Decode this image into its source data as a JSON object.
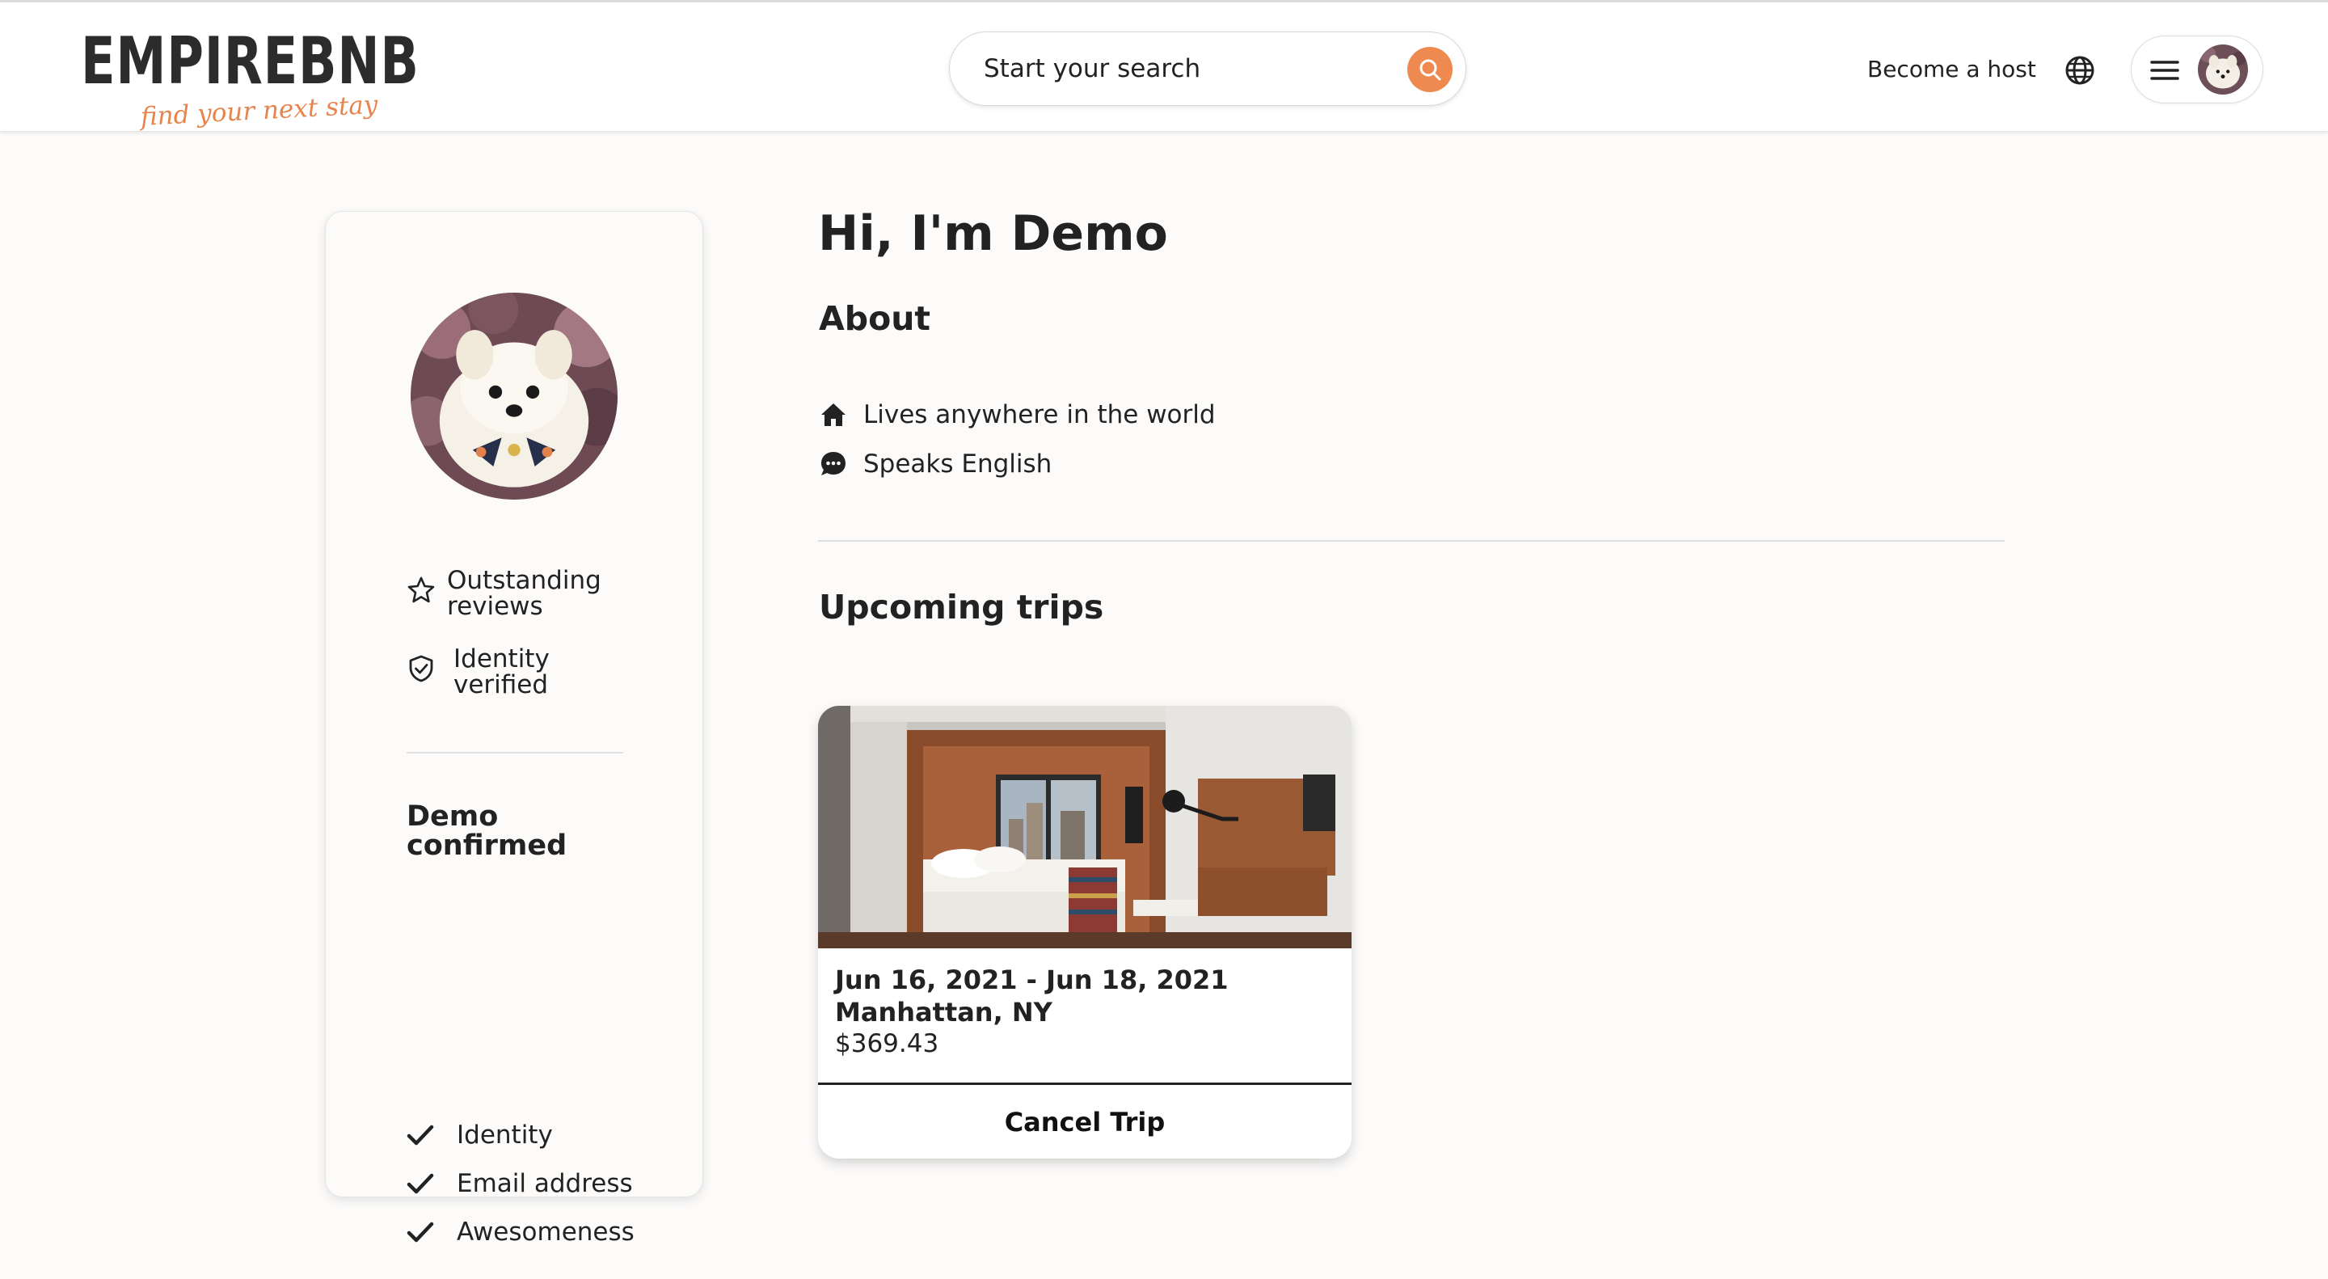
{
  "brand": {
    "name": "EMPIREBNB",
    "tagline": "find your next stay",
    "accent_color": "#ee8a4f"
  },
  "header": {
    "search": {
      "placeholder": "Start your search",
      "icon": "search-icon"
    },
    "become_host_label": "Become a host",
    "globe_icon": "globe-icon",
    "menu_icon": "hamburger-menu-icon",
    "avatar": "user-avatar"
  },
  "profile_card": {
    "badges": [
      {
        "icon": "star-icon",
        "label": "Outstanding reviews"
      },
      {
        "icon": "shield-check-icon",
        "label": "Identity verified"
      }
    ],
    "confirmed_title": "Demo confirmed",
    "confirmed_items": [
      "Identity",
      "Email address",
      "Awesomeness"
    ]
  },
  "main": {
    "greeting": "Hi, I'm Demo",
    "about_title": "About",
    "about_items": [
      {
        "icon": "home-icon",
        "text": "Lives anywhere in the world"
      },
      {
        "icon": "chat-bubble-icon",
        "text": "Speaks English"
      }
    ],
    "trips_title": "Upcoming trips",
    "trips": [
      {
        "dates": "Jun 16, 2021 - Jun 18, 2021",
        "location": "Manhattan, NY",
        "price": "$369.43",
        "cancel_label": "Cancel Trip"
      }
    ]
  }
}
